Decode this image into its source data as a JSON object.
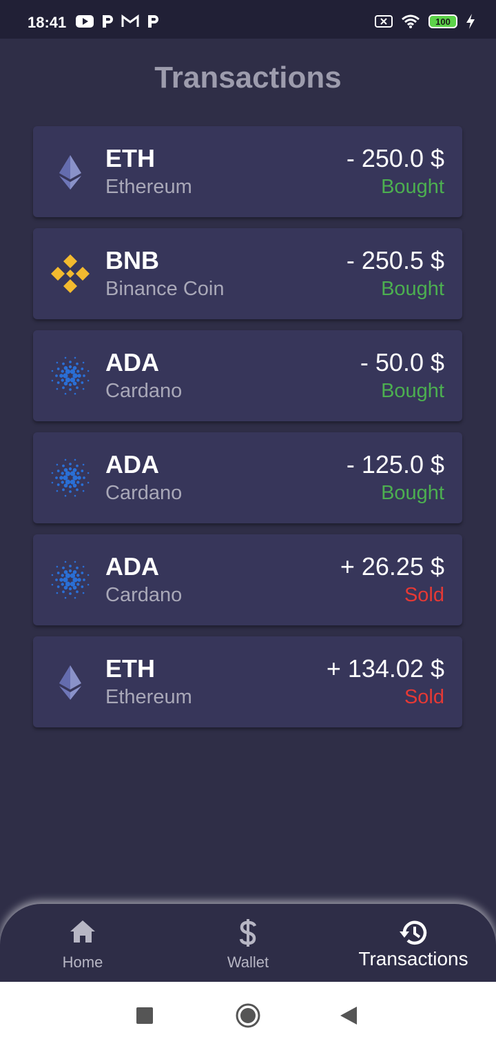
{
  "status_bar": {
    "time": "18:41",
    "battery": "100",
    "icons_left": [
      "youtube-icon",
      "p-app-icon",
      "gmail-icon",
      "p-app-icon"
    ],
    "icons_right": [
      "sim-off-icon",
      "wifi-icon",
      "battery-icon",
      "charging-icon"
    ]
  },
  "page": {
    "title": "Transactions"
  },
  "colors": {
    "bought": "#4caf50",
    "sold": "#e53935",
    "card": "#37365a",
    "background": "#2f2e47"
  },
  "transactions": [
    {
      "symbol": "ETH",
      "name": "Ethereum",
      "amount": "- 250.0 $",
      "status": "Bought",
      "icon": "ethereum-icon"
    },
    {
      "symbol": "BNB",
      "name": "Binance Coin",
      "amount": "- 250.5 $",
      "status": "Bought",
      "icon": "binance-icon"
    },
    {
      "symbol": "ADA",
      "name": "Cardano",
      "amount": "- 50.0 $",
      "status": "Bought",
      "icon": "cardano-icon"
    },
    {
      "symbol": "ADA",
      "name": "Cardano",
      "amount": "- 125.0 $",
      "status": "Bought",
      "icon": "cardano-icon"
    },
    {
      "symbol": "ADA",
      "name": "Cardano",
      "amount": "+ 26.25 $",
      "status": "Sold",
      "icon": "cardano-icon"
    },
    {
      "symbol": "ETH",
      "name": "Ethereum",
      "amount": "+ 134.02 $",
      "status": "Sold",
      "icon": "ethereum-icon"
    }
  ],
  "bottom_nav": {
    "items": [
      {
        "label": "Home",
        "icon": "home-icon",
        "active": false
      },
      {
        "label": "Wallet",
        "icon": "dollar-icon",
        "active": false
      },
      {
        "label": "Transactions",
        "icon": "history-icon",
        "active": true
      }
    ]
  },
  "system_nav": {
    "icons": [
      "recents-square-icon",
      "home-circle-icon",
      "back-triangle-icon"
    ]
  }
}
